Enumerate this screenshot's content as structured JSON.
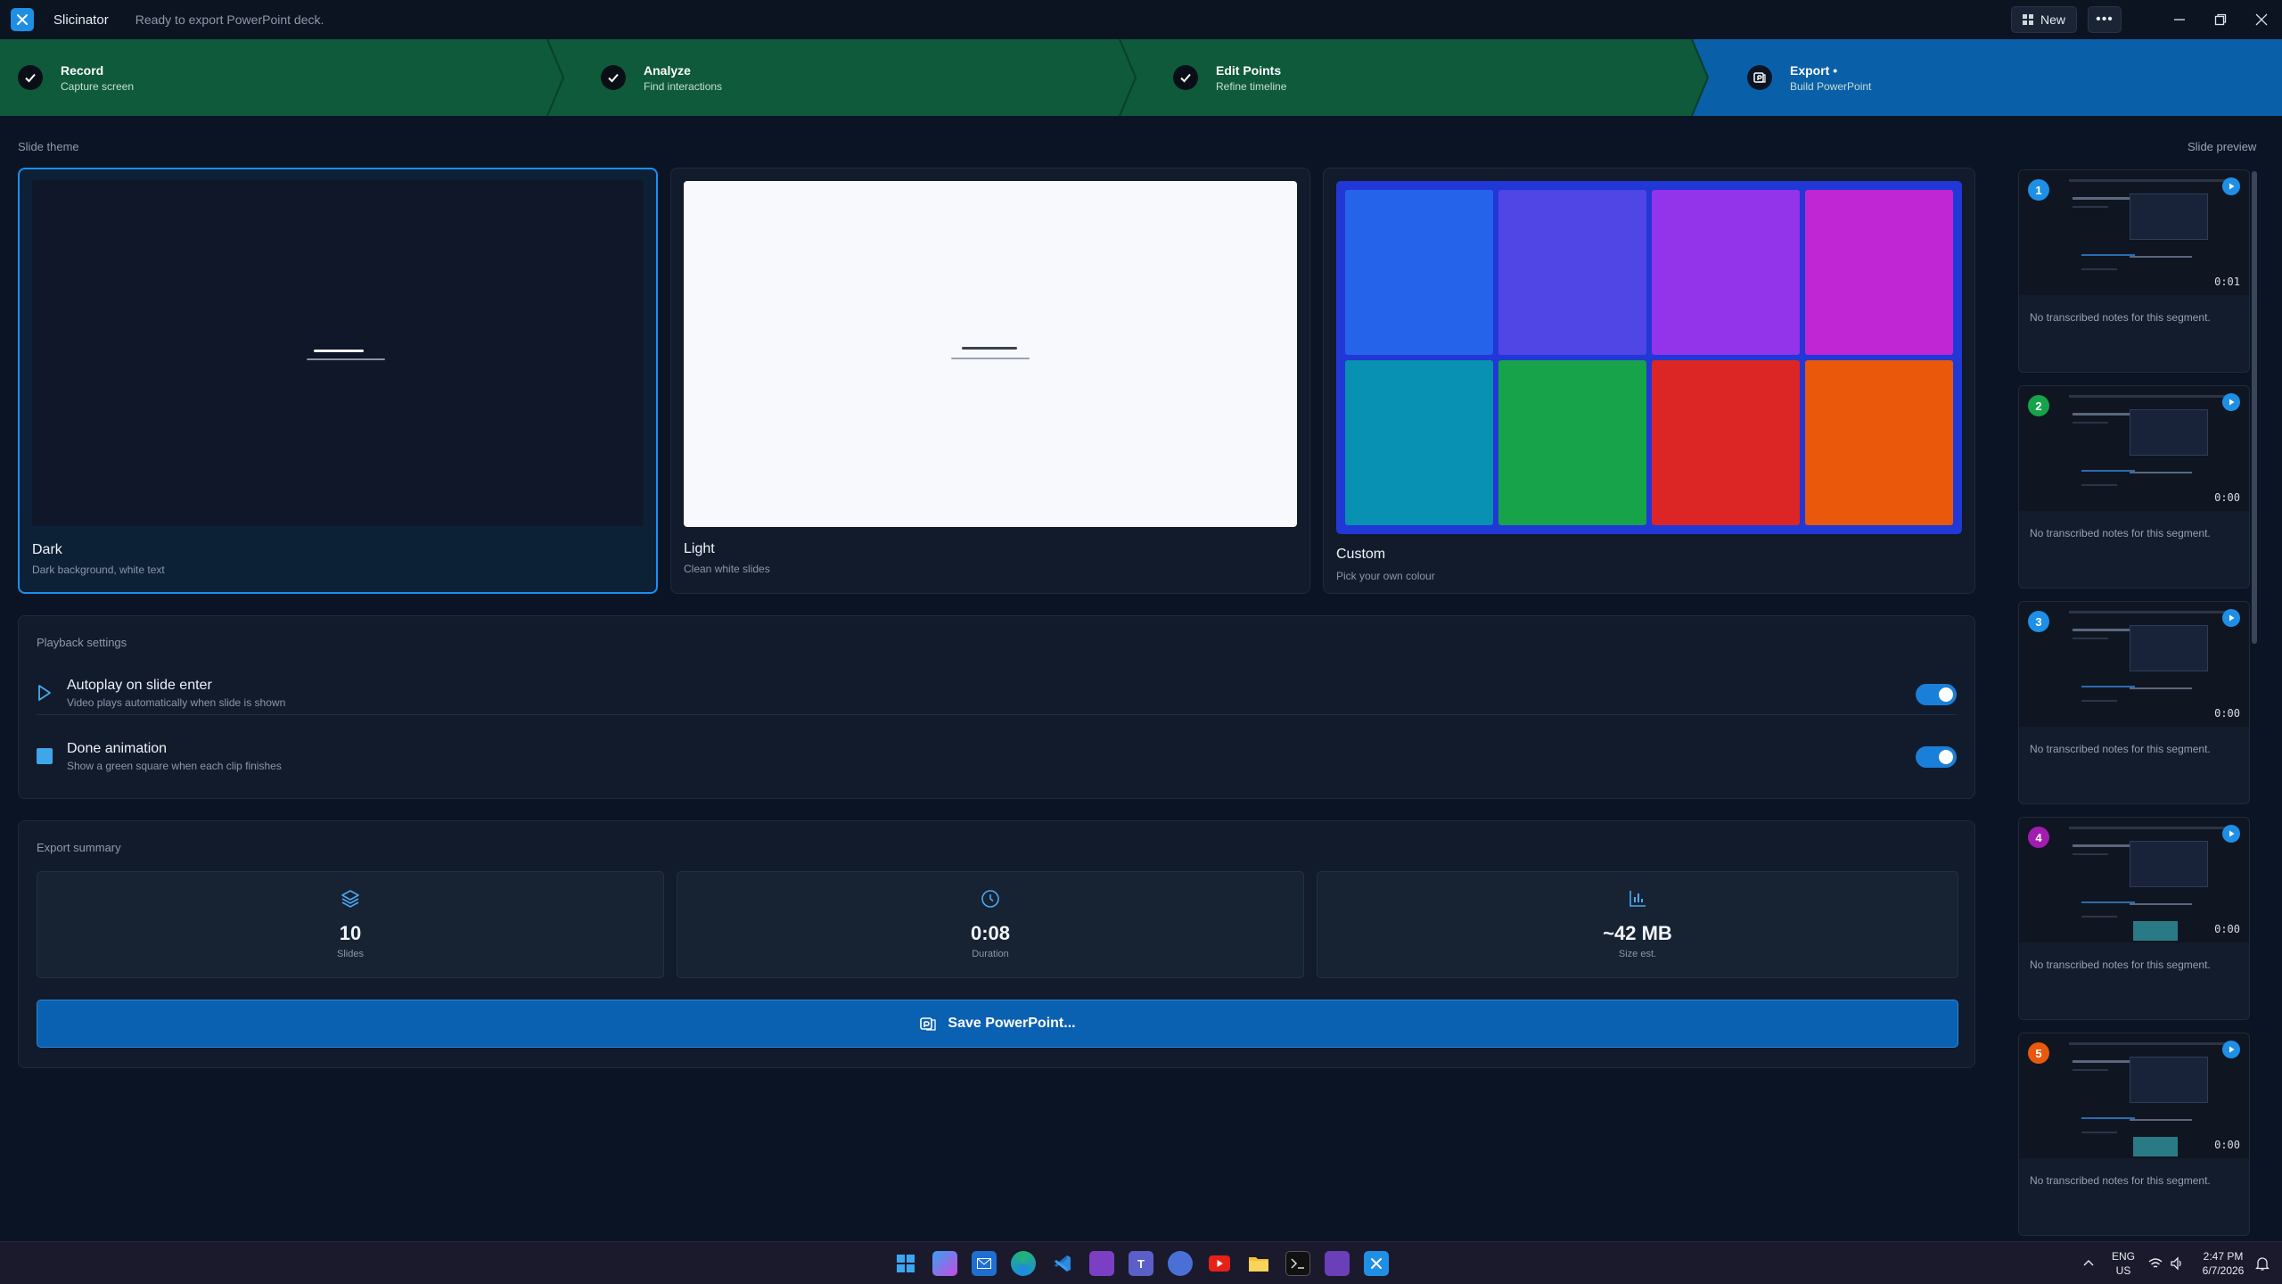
{
  "app": {
    "name": "Slicinator",
    "status": "Ready to export PowerPoint deck.",
    "new_label": "New",
    "more_label": "•••"
  },
  "steps": [
    {
      "title": "Record",
      "subtitle": "Capture screen",
      "state": "done"
    },
    {
      "title": "Analyze",
      "subtitle": "Find interactions",
      "state": "done"
    },
    {
      "title": "Edit Points",
      "subtitle": "Refine timeline",
      "state": "done"
    },
    {
      "title": "Export •",
      "subtitle": "Build PowerPoint",
      "state": "active"
    }
  ],
  "slide_theme": {
    "label": "Slide theme",
    "options": [
      {
        "name": "Dark",
        "description": "Dark background, white text",
        "selected": true
      },
      {
        "name": "Light",
        "description": "Clean white slides",
        "selected": false
      },
      {
        "name": "Custom",
        "description": "Pick your own colour",
        "selected": false
      }
    ],
    "custom_swatches": [
      "#2563eb",
      "#4f46e5",
      "#9333ea",
      "#c026d3",
      "#0891b2",
      "#16a34a",
      "#dc2626",
      "#ea580c"
    ]
  },
  "playback": {
    "label": "Playback settings",
    "settings": [
      {
        "title": "Autoplay on slide enter",
        "subtitle": "Video plays automatically when slide is shown",
        "enabled": true
      },
      {
        "title": "Done animation",
        "subtitle": "Show a green square when each clip finishes",
        "enabled": true
      }
    ]
  },
  "summary": {
    "label": "Export summary",
    "stats": [
      {
        "value": "10",
        "label": "Slides",
        "icon": "layers-icon"
      },
      {
        "value": "0:08",
        "label": "Duration",
        "icon": "clock-icon"
      },
      {
        "value": "~42 MB",
        "label": "Size est.",
        "icon": "bar-chart-icon"
      }
    ],
    "save_label": "Save PowerPoint..."
  },
  "preview": {
    "label": "Slide preview",
    "slides": [
      {
        "number": "1",
        "time": "0:01",
        "note": "No transcribed notes for this segment.",
        "badge_color": "#1d8fe6"
      },
      {
        "number": "2",
        "time": "0:00",
        "note": "No transcribed notes for this segment.",
        "badge_color": "#16a34a"
      },
      {
        "number": "3",
        "time": "0:00",
        "note": "No transcribed notes for this segment.",
        "badge_color": "#1d8fe6"
      },
      {
        "number": "4",
        "time": "0:00",
        "note": "No transcribed notes for this segment.",
        "badge_color": "#a21caf"
      },
      {
        "number": "5",
        "time": "0:00",
        "note": "No transcribed notes for this segment.",
        "badge_color": "#ea580c"
      }
    ]
  },
  "taskbar": {
    "lang_top": "ENG",
    "lang_bottom": "US",
    "time": "2:47 PM",
    "date": "6/7/2026"
  },
  "colors": {
    "accent": "#1a8ff0",
    "step_done": "#0e5a3b",
    "step_active": "#0a5fa9",
    "toggle_on": "#1a7fd9"
  }
}
